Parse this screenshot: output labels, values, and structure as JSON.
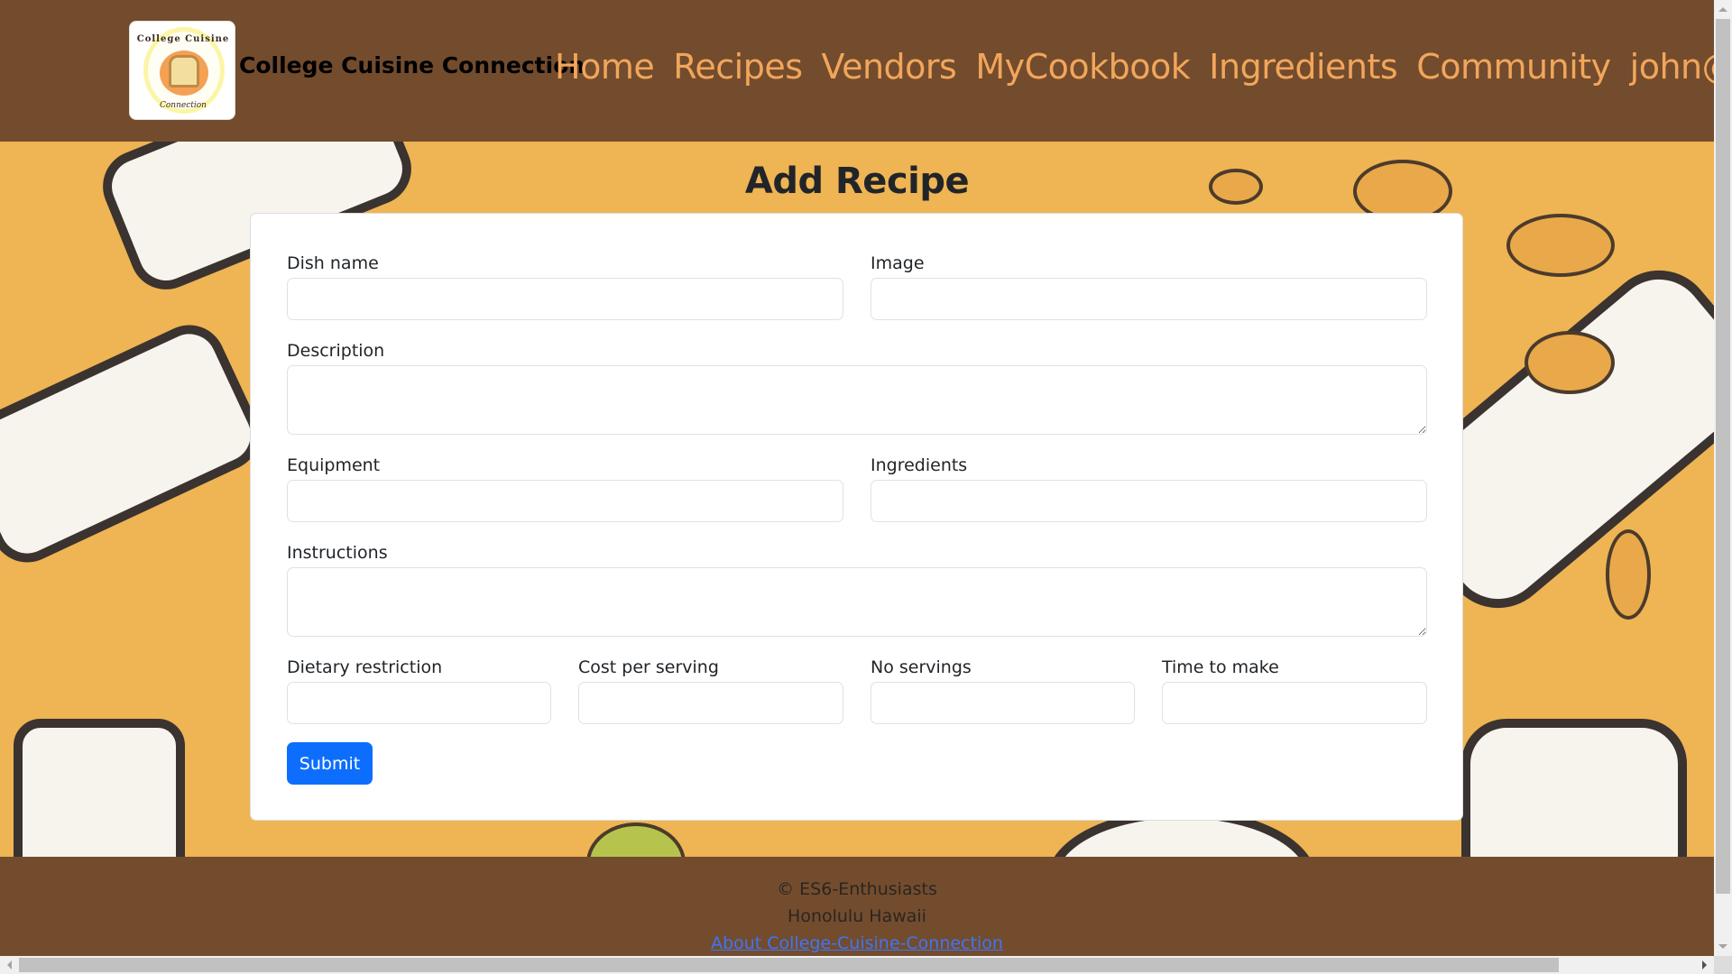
{
  "navbar": {
    "logo": {
      "top_text": "College Cuisine",
      "bottom_text": "Connection"
    },
    "brand": "College Cuisine Connection",
    "links": [
      {
        "label": "Home"
      },
      {
        "label": "Recipes"
      },
      {
        "label": "Vendors"
      },
      {
        "label": "MyCookbook"
      },
      {
        "label": "Ingredients"
      },
      {
        "label": "Community"
      },
      {
        "label": "john@fo"
      }
    ],
    "colors": {
      "background": "#734c2e",
      "link": "#f2a65a"
    }
  },
  "main": {
    "title": "Add Recipe",
    "form": {
      "fields": {
        "dish_name": {
          "label": "Dish name",
          "value": "",
          "placeholder": ""
        },
        "image": {
          "label": "Image",
          "value": "",
          "placeholder": ""
        },
        "description": {
          "label": "Description",
          "value": "",
          "placeholder": ""
        },
        "equipment": {
          "label": "Equipment",
          "value": "",
          "placeholder": ""
        },
        "ingredients": {
          "label": "Ingredients",
          "value": "",
          "placeholder": ""
        },
        "instructions": {
          "label": "Instructions",
          "value": "",
          "placeholder": ""
        },
        "dietary_restriction": {
          "label": "Dietary restriction",
          "value": "",
          "placeholder": ""
        },
        "cost_per_serving": {
          "label": "Cost per serving",
          "value": "",
          "placeholder": ""
        },
        "no_servings": {
          "label": "No servings",
          "value": "",
          "placeholder": ""
        },
        "time_to_make": {
          "label": "Time to make",
          "value": "",
          "placeholder": ""
        }
      },
      "submit_label": "Submit",
      "submit_color": "#0d6efd"
    }
  },
  "footer": {
    "copyright": "© ES6-Enthusiasts",
    "location": "Honolulu Hawaii",
    "about_link": "About College-Cuisine-Connection",
    "link_color": "#3d76f6"
  }
}
